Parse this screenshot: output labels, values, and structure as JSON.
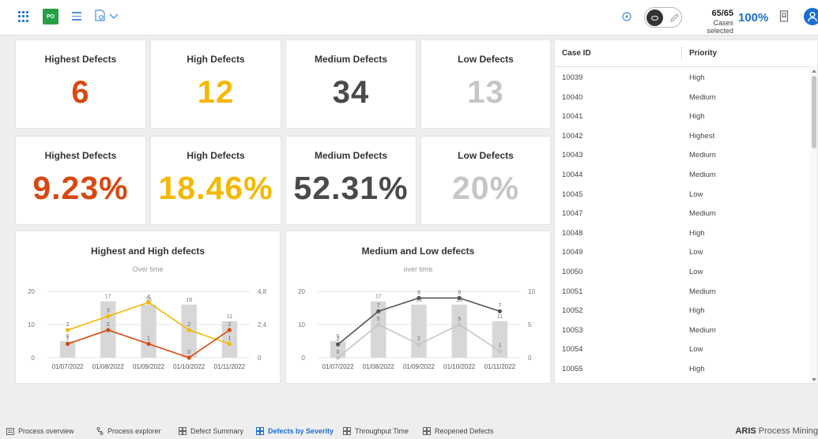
{
  "toolbar": {
    "app_badge": "PO",
    "cases_count": "65/65",
    "cases_label": "Cases selected",
    "cases_percent": "100%",
    "icons": [
      "apps-grid-icon",
      "menu-icon",
      "settings-icon",
      "chevron-down-icon",
      "refresh-icon",
      "eye-icon",
      "pencil-icon",
      "bookmark-icon",
      "user-icon"
    ]
  },
  "kpis_count": [
    {
      "title": "Highest Defects",
      "value": "6",
      "color": "#d9480f"
    },
    {
      "title": "High Defects",
      "value": "12",
      "color": "#f5b800"
    },
    {
      "title": "Medium Defects",
      "value": "34",
      "color": "#4a4a4a"
    },
    {
      "title": "Low Defects",
      "value": "13",
      "color": "#c6c6c6"
    }
  ],
  "kpis_pct": [
    {
      "title": "Highest Defects",
      "value": "9.23%",
      "color": "#d9480f"
    },
    {
      "title": "High Defects",
      "value": "18.46%",
      "color": "#f5b800"
    },
    {
      "title": "Medium Defects",
      "value": "52.31%",
      "color": "#4a4a4a"
    },
    {
      "title": "Low Defects",
      "value": "20%",
      "color": "#c6c6c6"
    }
  ],
  "chart_data": [
    {
      "type": "bar",
      "title": "Highest and High defects",
      "subtitle": "Over time",
      "categories": [
        "01/07/2022",
        "01/08/2022",
        "01/09/2022",
        "01/10/2022",
        "01/11/2022"
      ],
      "left_axis": {
        "ylim": [
          0,
          20
        ],
        "ticks": [
          "0",
          "10",
          "20"
        ]
      },
      "right_axis": {
        "ylim": [
          0,
          4.8
        ],
        "ticks": [
          "0",
          "2,4",
          "4,8"
        ]
      },
      "bars": {
        "values": [
          5,
          17,
          16,
          16,
          11
        ],
        "color": "#d7d7d7"
      },
      "series": [
        {
          "values": [
            2,
            3,
            4,
            2,
            1
          ],
          "color": "#f5b800",
          "axis": "right"
        },
        {
          "values": [
            1,
            2,
            1,
            0,
            2
          ],
          "color": "#d9480f",
          "axis": "right"
        }
      ]
    },
    {
      "type": "bar",
      "title": "Medium and Low defects",
      "subtitle": "over time",
      "categories": [
        "01/07/2022",
        "01/08/2022",
        "01/09/2022",
        "01/10/2022",
        "01/11/2022"
      ],
      "left_axis": {
        "ylim": [
          0,
          20
        ],
        "ticks": [
          "0",
          "10",
          "20"
        ]
      },
      "right_axis": {
        "ylim": [
          0,
          10
        ],
        "ticks": [
          "0",
          "5",
          "10"
        ]
      },
      "bars": {
        "values": [
          5,
          17,
          16,
          16,
          11
        ],
        "color": "#d7d7d7"
      },
      "series": [
        {
          "values": [
            2,
            7,
            9,
            9,
            7
          ],
          "color": "#555555",
          "axis": "right"
        },
        {
          "values": [
            0,
            5,
            2,
            5,
            1
          ],
          "color": "#c6c6c6",
          "axis": "right"
        }
      ]
    }
  ],
  "table": {
    "headers": [
      "Case ID",
      "Priority"
    ],
    "rows": [
      [
        "10039",
        "High"
      ],
      [
        "10040",
        "Medium"
      ],
      [
        "10041",
        "High"
      ],
      [
        "10042",
        "Highest"
      ],
      [
        "10043",
        "Medium"
      ],
      [
        "10044",
        "Medium"
      ],
      [
        "10045",
        "Low"
      ],
      [
        "10047",
        "Medium"
      ],
      [
        "10048",
        "High"
      ],
      [
        "10049",
        "Low"
      ],
      [
        "10050",
        "Low"
      ],
      [
        "10051",
        "Medium"
      ],
      [
        "10052",
        "High"
      ],
      [
        "10053",
        "Medium"
      ],
      [
        "10054",
        "Low"
      ],
      [
        "10055",
        "High"
      ]
    ]
  },
  "tabs": [
    {
      "label": "Process overview",
      "icon": "list-icon",
      "active": false
    },
    {
      "label": "Process explorer",
      "icon": "process-icon",
      "active": false
    },
    {
      "label": "Defect Summary",
      "icon": "dashboard-icon",
      "active": false
    },
    {
      "label": "Defects by Severity",
      "icon": "dashboard-icon",
      "active": true
    },
    {
      "label": "Throughput Time",
      "icon": "dashboard-icon",
      "active": false
    },
    {
      "label": "Reopened Defects",
      "icon": "dashboard-icon",
      "active": false
    }
  ],
  "brand": {
    "bold": "ARIS",
    "rest": "Process Mining"
  }
}
